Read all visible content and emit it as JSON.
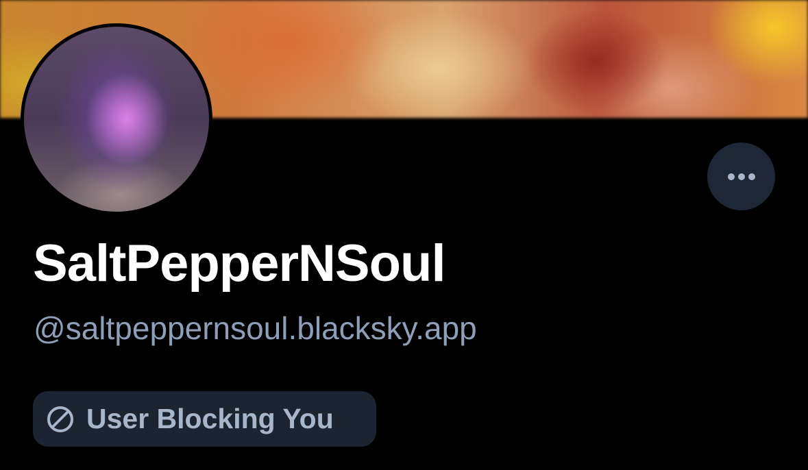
{
  "profile": {
    "display_name": "SaltPepperNSoul",
    "handle": "@saltpeppernsoul.blacksky.app",
    "block_status": "User Blocking You"
  },
  "icons": {
    "more": "ellipsis-horizontal-icon",
    "block": "block-circle-slash-icon"
  },
  "colors": {
    "background": "#000000",
    "name_text": "#ffffff",
    "handle_text": "#8f9fb8",
    "pill_background": "#1c2431",
    "pill_text": "#a8b6cc",
    "more_button_background": "#1e2735"
  }
}
